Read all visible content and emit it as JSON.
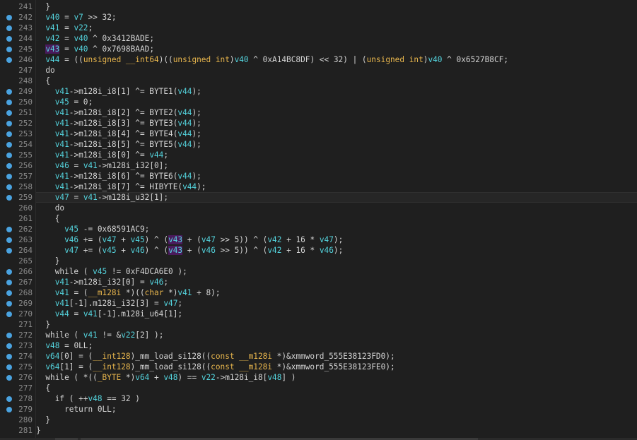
{
  "editor": {
    "lines": [
      {
        "n": "241",
        "bp": false,
        "tokens": [
          [
            "txt",
            "  }"
          ]
        ]
      },
      {
        "n": "242",
        "bp": true,
        "tokens": [
          [
            "txt",
            "  "
          ],
          [
            "var",
            "v40"
          ],
          [
            "txt",
            " = "
          ],
          [
            "var",
            "v7"
          ],
          [
            "txt",
            " >> 32;"
          ]
        ]
      },
      {
        "n": "243",
        "bp": true,
        "tokens": [
          [
            "txt",
            "  "
          ],
          [
            "var",
            "v41"
          ],
          [
            "txt",
            " = "
          ],
          [
            "var",
            "v22"
          ],
          [
            "txt",
            ";"
          ]
        ]
      },
      {
        "n": "244",
        "bp": true,
        "tokens": [
          [
            "txt",
            "  "
          ],
          [
            "var",
            "v42"
          ],
          [
            "txt",
            " = "
          ],
          [
            "var",
            "v40"
          ],
          [
            "txt",
            " ^ 0x3412BADE;"
          ]
        ]
      },
      {
        "n": "245",
        "bp": true,
        "tokens": [
          [
            "txt",
            "  "
          ],
          [
            "hl",
            "v43"
          ],
          [
            "txt",
            " = "
          ],
          [
            "var",
            "v40"
          ],
          [
            "txt",
            " ^ 0x7698BAAD;"
          ]
        ]
      },
      {
        "n": "246",
        "bp": true,
        "tokens": [
          [
            "txt",
            "  "
          ],
          [
            "var",
            "v44"
          ],
          [
            "txt",
            " = (("
          ],
          [
            "kw",
            "unsigned __int64"
          ],
          [
            "txt",
            ")(("
          ],
          [
            "kw",
            "unsigned int"
          ],
          [
            "txt",
            ")"
          ],
          [
            "var",
            "v40"
          ],
          [
            "txt",
            " ^ 0xA14BC8DF) << 32) | ("
          ],
          [
            "kw",
            "unsigned int"
          ],
          [
            "txt",
            ")"
          ],
          [
            "var",
            "v40"
          ],
          [
            "txt",
            " ^ 0x6527B8CF;"
          ]
        ]
      },
      {
        "n": "247",
        "bp": false,
        "tokens": [
          [
            "txt",
            "  do"
          ]
        ]
      },
      {
        "n": "248",
        "bp": false,
        "tokens": [
          [
            "txt",
            "  {"
          ]
        ]
      },
      {
        "n": "249",
        "bp": true,
        "tokens": [
          [
            "txt",
            "    "
          ],
          [
            "var",
            "v41"
          ],
          [
            "txt",
            "->m128i_i8[1] ^= BYTE1("
          ],
          [
            "var",
            "v44"
          ],
          [
            "txt",
            ");"
          ]
        ]
      },
      {
        "n": "250",
        "bp": true,
        "tokens": [
          [
            "txt",
            "    "
          ],
          [
            "var",
            "v45"
          ],
          [
            "txt",
            " = 0;"
          ]
        ]
      },
      {
        "n": "251",
        "bp": true,
        "tokens": [
          [
            "txt",
            "    "
          ],
          [
            "var",
            "v41"
          ],
          [
            "txt",
            "->m128i_i8[2] ^= BYTE2("
          ],
          [
            "var",
            "v44"
          ],
          [
            "txt",
            ");"
          ]
        ]
      },
      {
        "n": "252",
        "bp": true,
        "tokens": [
          [
            "txt",
            "    "
          ],
          [
            "var",
            "v41"
          ],
          [
            "txt",
            "->m128i_i8[3] ^= BYTE3("
          ],
          [
            "var",
            "v44"
          ],
          [
            "txt",
            ");"
          ]
        ]
      },
      {
        "n": "253",
        "bp": true,
        "tokens": [
          [
            "txt",
            "    "
          ],
          [
            "var",
            "v41"
          ],
          [
            "txt",
            "->m128i_i8[4] ^= BYTE4("
          ],
          [
            "var",
            "v44"
          ],
          [
            "txt",
            ");"
          ]
        ]
      },
      {
        "n": "254",
        "bp": true,
        "tokens": [
          [
            "txt",
            "    "
          ],
          [
            "var",
            "v41"
          ],
          [
            "txt",
            "->m128i_i8[5] ^= BYTE5("
          ],
          [
            "var",
            "v44"
          ],
          [
            "txt",
            ");"
          ]
        ]
      },
      {
        "n": "255",
        "bp": true,
        "tokens": [
          [
            "txt",
            "    "
          ],
          [
            "var",
            "v41"
          ],
          [
            "txt",
            "->m128i_i8[0] ^= "
          ],
          [
            "var",
            "v44"
          ],
          [
            "txt",
            ";"
          ]
        ]
      },
      {
        "n": "256",
        "bp": true,
        "tokens": [
          [
            "txt",
            "    "
          ],
          [
            "var",
            "v46"
          ],
          [
            "txt",
            " = "
          ],
          [
            "var",
            "v41"
          ],
          [
            "txt",
            "->m128i_i32[0];"
          ]
        ]
      },
      {
        "n": "257",
        "bp": true,
        "tokens": [
          [
            "txt",
            "    "
          ],
          [
            "var",
            "v41"
          ],
          [
            "txt",
            "->m128i_i8[6] ^= BYTE6("
          ],
          [
            "var",
            "v44"
          ],
          [
            "txt",
            ");"
          ]
        ]
      },
      {
        "n": "258",
        "bp": true,
        "tokens": [
          [
            "txt",
            "    "
          ],
          [
            "var",
            "v41"
          ],
          [
            "txt",
            "->m128i_i8[7] ^= HIBYTE("
          ],
          [
            "var",
            "v44"
          ],
          [
            "txt",
            ");"
          ]
        ]
      },
      {
        "n": "259",
        "bp": true,
        "cur": true,
        "tokens": [
          [
            "txt",
            "    "
          ],
          [
            "var",
            "v47"
          ],
          [
            "txt",
            " = "
          ],
          [
            "var",
            "v41"
          ],
          [
            "txt",
            "->m128i_u32[1];"
          ]
        ]
      },
      {
        "n": "260",
        "bp": false,
        "tokens": [
          [
            "txt",
            "    do"
          ]
        ]
      },
      {
        "n": "261",
        "bp": false,
        "tokens": [
          [
            "txt",
            "    {"
          ]
        ]
      },
      {
        "n": "262",
        "bp": true,
        "tokens": [
          [
            "txt",
            "      "
          ],
          [
            "var",
            "v45"
          ],
          [
            "txt",
            " -= 0x68591AC9;"
          ]
        ]
      },
      {
        "n": "263",
        "bp": true,
        "tokens": [
          [
            "txt",
            "      "
          ],
          [
            "var",
            "v46"
          ],
          [
            "txt",
            " += ("
          ],
          [
            "var",
            "v47"
          ],
          [
            "txt",
            " + "
          ],
          [
            "var",
            "v45"
          ],
          [
            "txt",
            ") ^ ("
          ],
          [
            "hl",
            "v43"
          ],
          [
            "txt",
            " + ("
          ],
          [
            "var",
            "v47"
          ],
          [
            "txt",
            " >> 5)) ^ ("
          ],
          [
            "var",
            "v42"
          ],
          [
            "txt",
            " + 16 * "
          ],
          [
            "var",
            "v47"
          ],
          [
            "txt",
            ");"
          ]
        ]
      },
      {
        "n": "264",
        "bp": true,
        "tokens": [
          [
            "txt",
            "      "
          ],
          [
            "var",
            "v47"
          ],
          [
            "txt",
            " += ("
          ],
          [
            "var",
            "v45"
          ],
          [
            "txt",
            " + "
          ],
          [
            "var",
            "v46"
          ],
          [
            "txt",
            ") ^ ("
          ],
          [
            "hl",
            "v43"
          ],
          [
            "txt",
            " + ("
          ],
          [
            "var",
            "v46"
          ],
          [
            "txt",
            " >> 5)) ^ ("
          ],
          [
            "var",
            "v42"
          ],
          [
            "txt",
            " + 16 * "
          ],
          [
            "var",
            "v46"
          ],
          [
            "txt",
            ");"
          ]
        ]
      },
      {
        "n": "265",
        "bp": false,
        "tokens": [
          [
            "txt",
            "    }"
          ]
        ]
      },
      {
        "n": "266",
        "bp": true,
        "tokens": [
          [
            "txt",
            "    while ( "
          ],
          [
            "var",
            "v45"
          ],
          [
            "txt",
            " != 0xF4DCA6E0 );"
          ]
        ]
      },
      {
        "n": "267",
        "bp": true,
        "tokens": [
          [
            "txt",
            "    "
          ],
          [
            "var",
            "v41"
          ],
          [
            "txt",
            "->m128i_i32[0] = "
          ],
          [
            "var",
            "v46"
          ],
          [
            "txt",
            ";"
          ]
        ]
      },
      {
        "n": "268",
        "bp": true,
        "tokens": [
          [
            "txt",
            "    "
          ],
          [
            "var",
            "v41"
          ],
          [
            "txt",
            " = ("
          ],
          [
            "kw",
            "__m128i"
          ],
          [
            "txt",
            " *)(("
          ],
          [
            "kw",
            "char"
          ],
          [
            "txt",
            " *)"
          ],
          [
            "var",
            "v41"
          ],
          [
            "txt",
            " + 8);"
          ]
        ]
      },
      {
        "n": "269",
        "bp": true,
        "tokens": [
          [
            "txt",
            "    "
          ],
          [
            "var",
            "v41"
          ],
          [
            "txt",
            "[-1].m128i_i32[3] = "
          ],
          [
            "var",
            "v47"
          ],
          [
            "txt",
            ";"
          ]
        ]
      },
      {
        "n": "270",
        "bp": true,
        "tokens": [
          [
            "txt",
            "    "
          ],
          [
            "var",
            "v44"
          ],
          [
            "txt",
            " = "
          ],
          [
            "var",
            "v41"
          ],
          [
            "txt",
            "[-1].m128i_u64[1];"
          ]
        ]
      },
      {
        "n": "271",
        "bp": false,
        "tokens": [
          [
            "txt",
            "  }"
          ]
        ]
      },
      {
        "n": "272",
        "bp": true,
        "tokens": [
          [
            "txt",
            "  while ( "
          ],
          [
            "var",
            "v41"
          ],
          [
            "txt",
            " != &"
          ],
          [
            "var",
            "v22"
          ],
          [
            "txt",
            "[2] );"
          ]
        ]
      },
      {
        "n": "273",
        "bp": true,
        "tokens": [
          [
            "txt",
            "  "
          ],
          [
            "var",
            "v48"
          ],
          [
            "txt",
            " = 0LL;"
          ]
        ]
      },
      {
        "n": "274",
        "bp": true,
        "tokens": [
          [
            "txt",
            "  "
          ],
          [
            "var",
            "v64"
          ],
          [
            "txt",
            "[0] = ("
          ],
          [
            "kw",
            "__int128"
          ],
          [
            "txt",
            ")_mm_load_si128(("
          ],
          [
            "kw",
            "const __m128i"
          ],
          [
            "txt",
            " *)&xmmword_555E38123FD0);"
          ]
        ]
      },
      {
        "n": "275",
        "bp": true,
        "tokens": [
          [
            "txt",
            "  "
          ],
          [
            "var",
            "v64"
          ],
          [
            "txt",
            "[1] = ("
          ],
          [
            "kw",
            "__int128"
          ],
          [
            "txt",
            ")_mm_load_si128(("
          ],
          [
            "kw",
            "const __m128i"
          ],
          [
            "txt",
            " *)&xmmword_555E38123FE0);"
          ]
        ]
      },
      {
        "n": "276",
        "bp": true,
        "tokens": [
          [
            "txt",
            "  while ( *(("
          ],
          [
            "kw",
            "_BYTE"
          ],
          [
            "txt",
            " *)"
          ],
          [
            "var",
            "v64"
          ],
          [
            "txt",
            " + "
          ],
          [
            "var",
            "v48"
          ],
          [
            "txt",
            ") == "
          ],
          [
            "var",
            "v22"
          ],
          [
            "txt",
            "->m128i_i8["
          ],
          [
            "var",
            "v48"
          ],
          [
            "txt",
            "] )"
          ]
        ]
      },
      {
        "n": "277",
        "bp": false,
        "tokens": [
          [
            "txt",
            "  {"
          ]
        ]
      },
      {
        "n": "278",
        "bp": true,
        "tokens": [
          [
            "txt",
            "    if ( ++"
          ],
          [
            "var",
            "v48"
          ],
          [
            "txt",
            " == 32 )"
          ]
        ]
      },
      {
        "n": "279",
        "bp": true,
        "tokens": [
          [
            "txt",
            "      return 0LL;"
          ]
        ]
      },
      {
        "n": "280",
        "bp": false,
        "tokens": [
          [
            "txt",
            "  }"
          ]
        ]
      },
      {
        "n": "281",
        "bp": false,
        "tokens": [
          [
            "txt",
            "}"
          ]
        ]
      }
    ]
  },
  "colors": {
    "background": "#1f1f1f",
    "text": "#d4d4d4",
    "variable": "#54d4de",
    "keyword": "#e8b64d",
    "highlight_bg": "#4a1a5c",
    "breakpoint": "#4aa3e0",
    "line_number": "#8a8a8a"
  }
}
